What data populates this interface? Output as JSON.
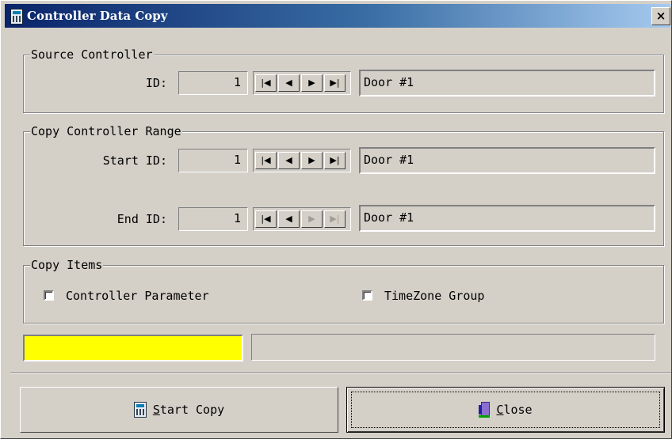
{
  "window": {
    "title": "Controller Data Copy",
    "close_glyph": "×"
  },
  "source": {
    "legend": "Source Controller",
    "id_label": "ID:",
    "id_value": "1",
    "name_value": "Door #1"
  },
  "range": {
    "legend": "Copy Controller Range",
    "start_label": "Start ID:",
    "start_value": "1",
    "start_name": "Door #1",
    "end_label": "End ID:",
    "end_value": "1",
    "end_name": "Door #1"
  },
  "nav": {
    "first": "|◀",
    "prev": "◀",
    "next": "▶",
    "last": "▶|"
  },
  "items": {
    "legend": "Copy Items",
    "controller_parameter": {
      "label": "Controller Parameter",
      "checked": false
    },
    "timezone_group": {
      "label": "TimeZone Group",
      "checked": false
    }
  },
  "status": {
    "progress_color": "#ffff00",
    "message": ""
  },
  "buttons": {
    "start_copy": {
      "accel": "S",
      "rest": "tart Copy",
      "icon": "copy-icon"
    },
    "close": {
      "accel": "C",
      "rest": "lose",
      "icon": "door-exit-icon"
    }
  }
}
